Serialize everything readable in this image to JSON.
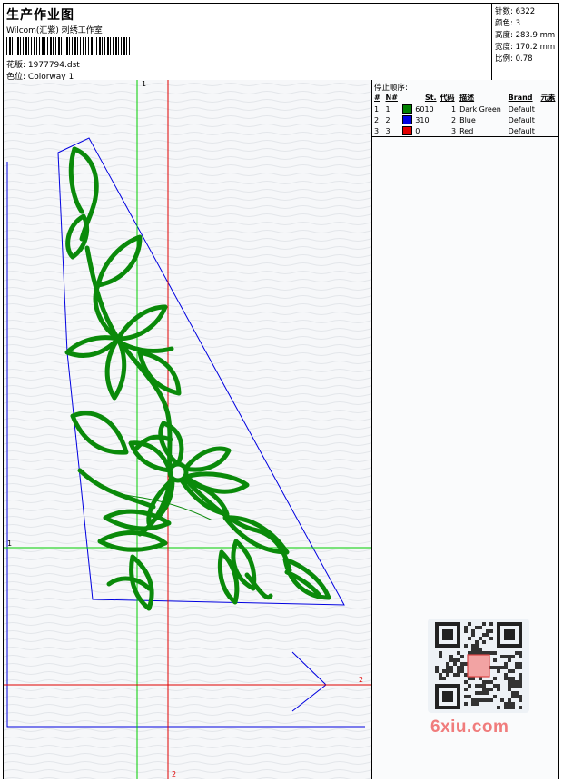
{
  "header": {
    "title": "生产作业图",
    "company": "Wilcom(汇紫) 刺绣工作室",
    "design_label": "花版:",
    "design_value": "1977794.dst",
    "colorway_label": "色位:",
    "colorway_value": "Colorway 1"
  },
  "stats": {
    "stitches_label": "针数:",
    "stitches_value": "6322",
    "colors_label": "颜色:",
    "colors_value": "3",
    "height_label": "高度:",
    "height_value": "283.9 mm",
    "width_label": "宽度:",
    "width_value": "170.2 mm",
    "ratio_label": "比例:",
    "ratio_value": "0.78"
  },
  "stop_sequence": {
    "title": "停止顺序:",
    "headers": {
      "index": "#",
      "needle": "N#",
      "stitches": "St.",
      "code": "代码",
      "description": "描述",
      "brand": "Brand",
      "element": "元素"
    },
    "rows": [
      {
        "index": "1.",
        "needle": "1",
        "color": "#008000",
        "stitches": "6010",
        "code": "1",
        "description": "Dark Green",
        "brand": "Default"
      },
      {
        "index": "2.",
        "needle": "2",
        "color": "#0000e0",
        "stitches": "310",
        "code": "2",
        "description": "Blue",
        "brand": "Default"
      },
      {
        "index": "3.",
        "needle": "3",
        "color": "#e00000",
        "stitches": "0",
        "code": "3",
        "description": "Red",
        "brand": "Default"
      }
    ]
  },
  "canvas": {
    "axis_green_top": "1",
    "axis_green_left": "1",
    "axis_red_right": "2",
    "axis_red_bottom": "2",
    "colors": {
      "green_axis": "#00cc00",
      "red_axis": "#e00000",
      "outline": "#0000e0",
      "stitch": "#0a8a0a"
    }
  },
  "watermark": "6xiu.com"
}
